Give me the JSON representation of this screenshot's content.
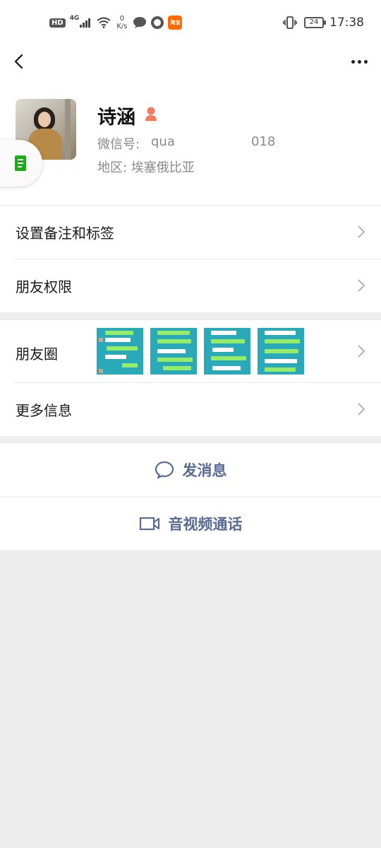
{
  "status_bar": {
    "hd": "HD",
    "network": "4G",
    "speed_value": "0",
    "speed_unit": "K/s",
    "taobao_label": "淘宝",
    "battery": "24",
    "time": "17:38"
  },
  "nav": {
    "back_icon": "chevron-left-icon",
    "more_icon": "more-dots-icon"
  },
  "profile": {
    "name": "诗涵",
    "gender_icon": "person-icon",
    "wechat_id_label": "微信号:",
    "wechat_id_value": "qua",
    "wechat_id_suffix": "018",
    "region_label": "地区:",
    "region_value": "埃塞俄比亚"
  },
  "menu": {
    "remark_tags": "设置备注和标签",
    "friend_permissions": "朋友权限",
    "moments": "朋友圈",
    "more_info": "更多信息"
  },
  "actions": {
    "send_message": "发消息",
    "video_call": "音视频通话"
  },
  "colors": {
    "accent_link": "#576b95",
    "background": "#ededed",
    "gender_female": "#f37b5e",
    "wechat_green": "#1aad19"
  }
}
